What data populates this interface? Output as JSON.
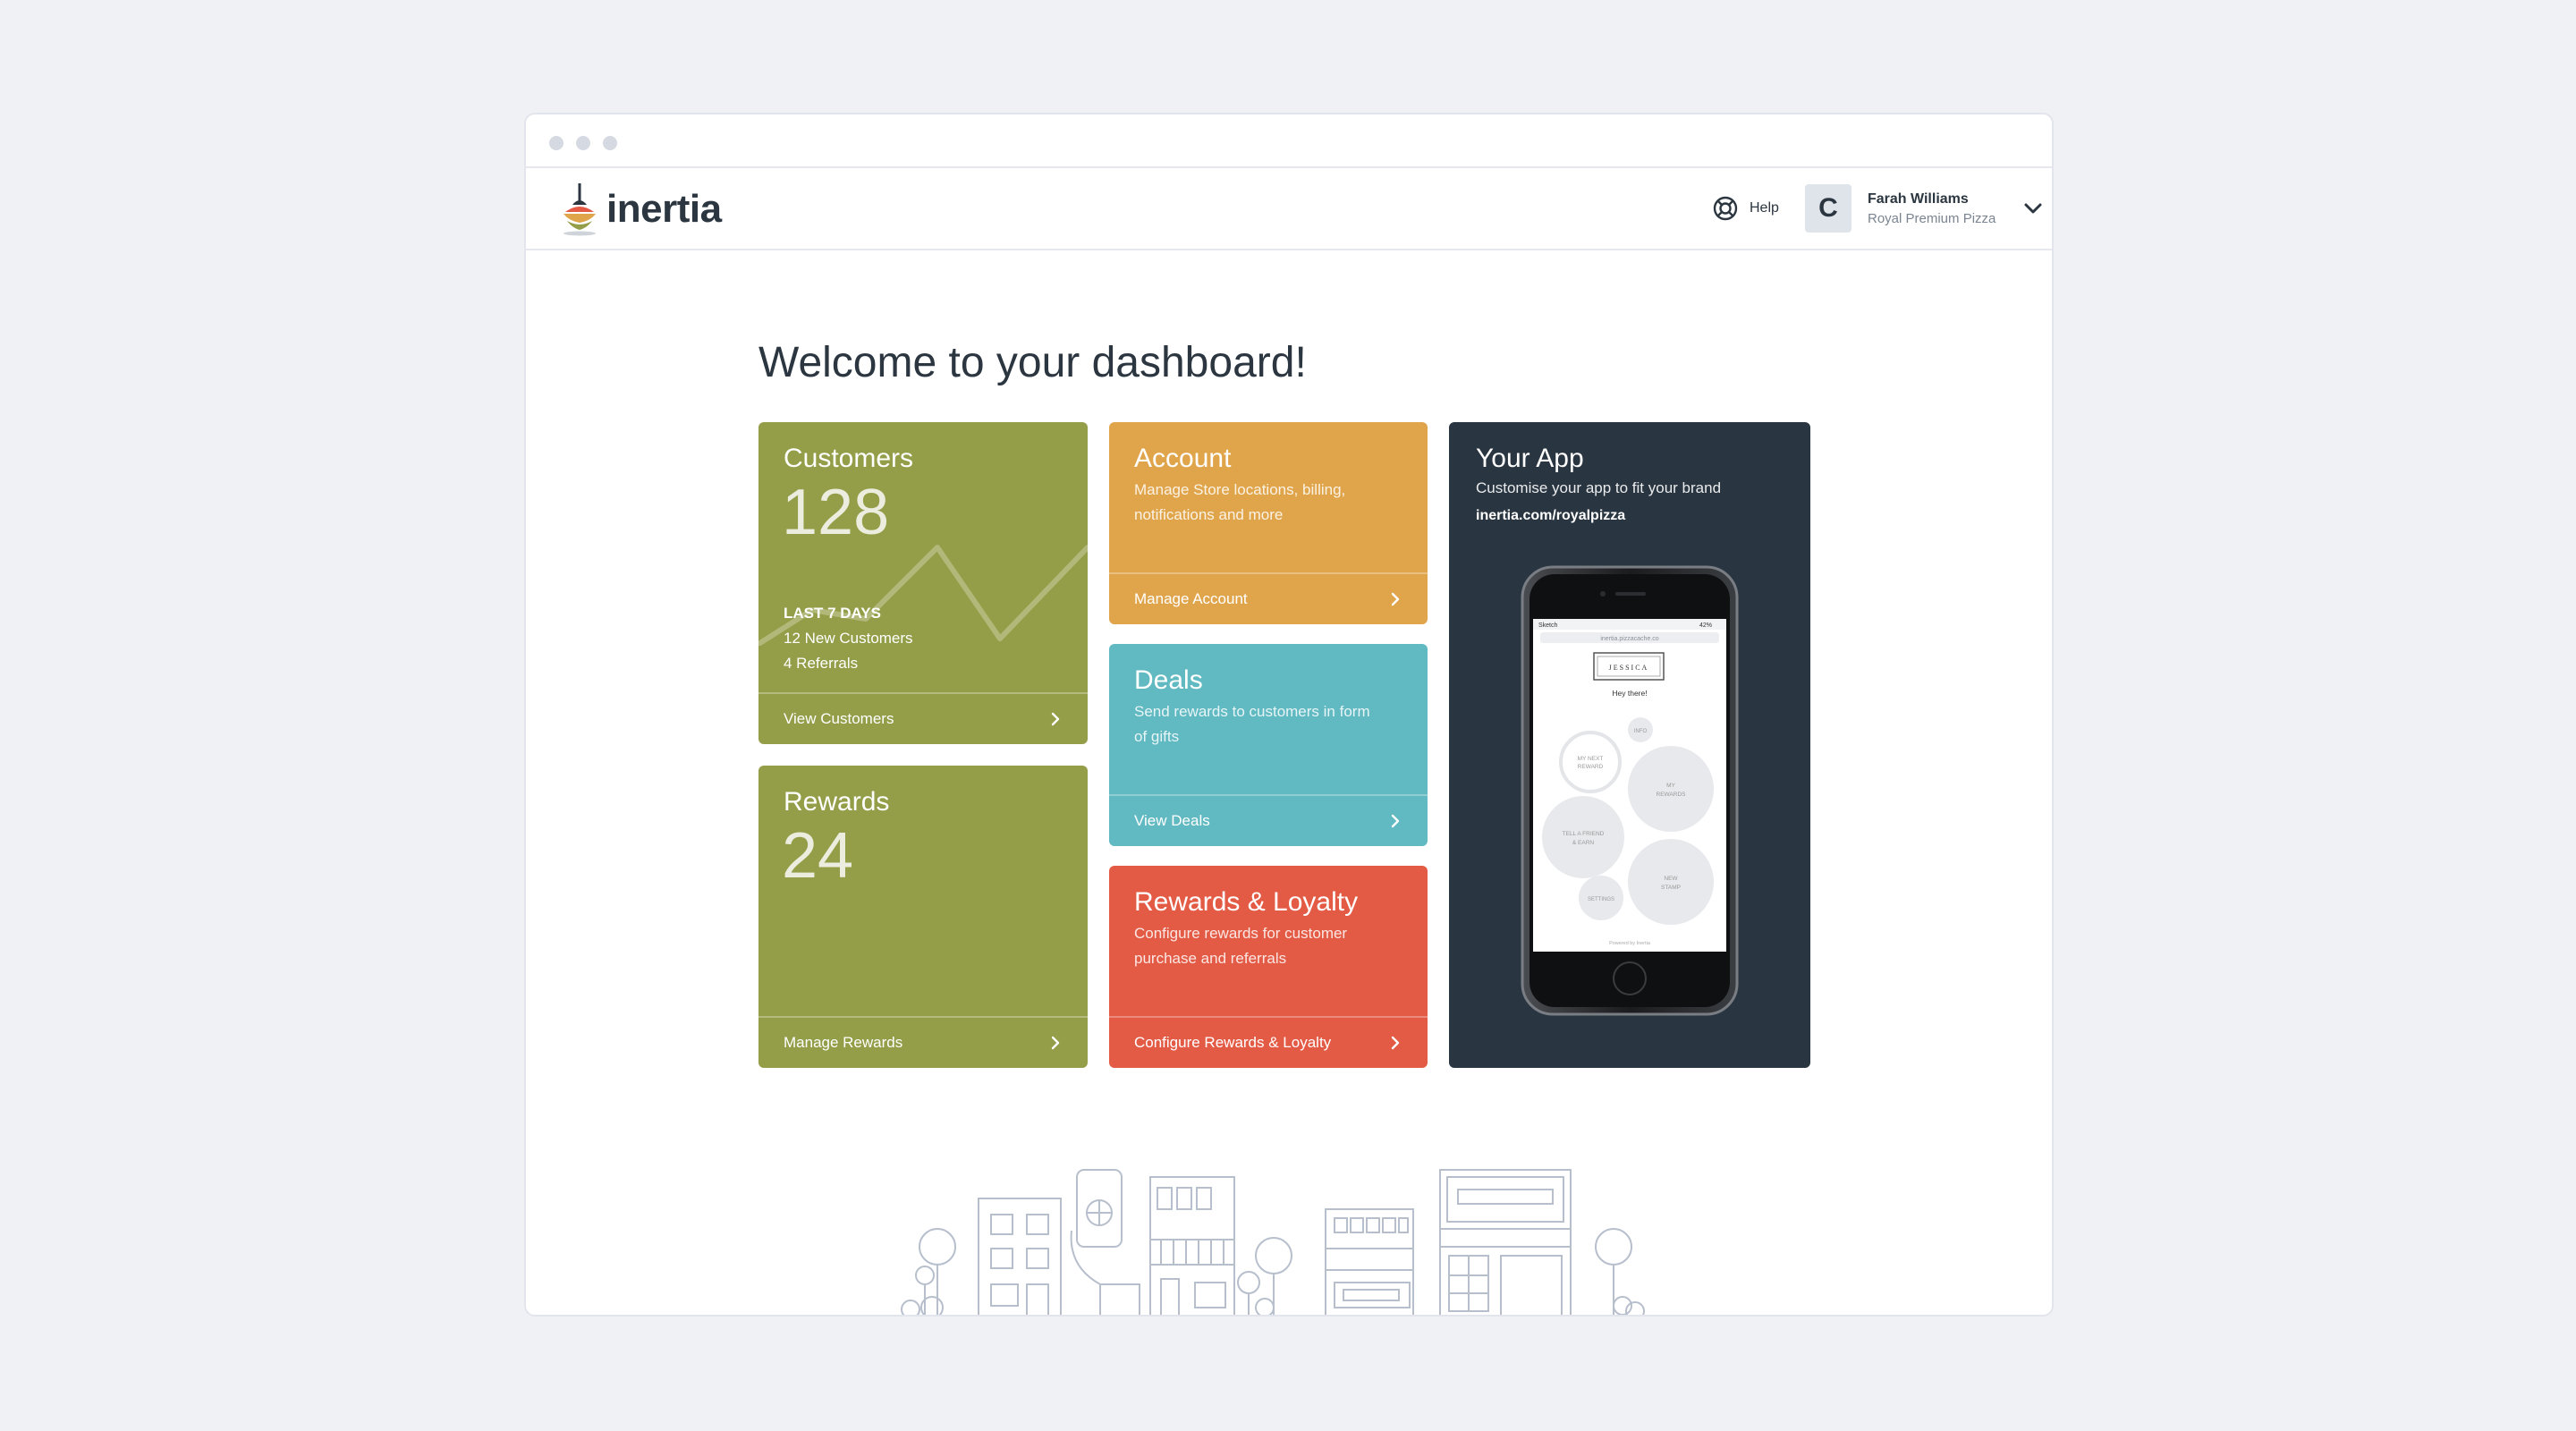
{
  "header": {
    "brand": "inertia",
    "help_label": "Help",
    "user": {
      "initial": "C",
      "name": "Farah Williams",
      "org": "Royal Premium Pizza"
    }
  },
  "page": {
    "title": "Welcome to your dashboard!"
  },
  "cards": {
    "customers": {
      "title": "Customers",
      "count": "128",
      "period_label": "LAST 7 DAYS",
      "new_customers": "12 New Customers",
      "referrals": "4 Referrals",
      "footer": "View Customers"
    },
    "rewards": {
      "title": "Rewards",
      "count": "24",
      "footer": "Manage Rewards"
    },
    "account": {
      "title": "Account",
      "desc_line1": "Manage Store locations, billing,",
      "desc_line2": "notifications and more",
      "footer": "Manage Account"
    },
    "deals": {
      "title": "Deals",
      "desc_line1": "Send rewards to customers in form",
      "desc_line2": "of gifts",
      "footer": "View Deals"
    },
    "loyalty": {
      "title": "Rewards & Loyalty",
      "desc_line1": "Configure rewards for customer",
      "desc_line2": "purchase and referrals",
      "footer": "Configure Rewards & Loyalty"
    },
    "app": {
      "title": "Your App",
      "desc": "Customise your app to fit your brand",
      "url": "inertia.com/royalpizza"
    }
  },
  "phone": {
    "carrier": "Sketch",
    "battery": "42%",
    "address": "inertia.pizzacache.co",
    "logo_text": "JESSICA",
    "greeting": "Hey there!",
    "bubbles": {
      "info": "INFO",
      "next_reward_1": "MY NEXT",
      "next_reward_2": "REWARD",
      "my_rewards_1": "MY",
      "my_rewards_2": "REWARDS",
      "tell_friend_1": "TELL A FRIEND",
      "tell_friend_2": "& EARN",
      "new_stamp_1": "NEW",
      "new_stamp_2": "STAMP",
      "settings": "SETTINGS"
    },
    "powered": "Powered by Inertia"
  },
  "colors": {
    "green": "#949d47",
    "orange": "#e0a54b",
    "teal": "#61b9c2",
    "red": "#e35a45",
    "dark": "#293540"
  }
}
